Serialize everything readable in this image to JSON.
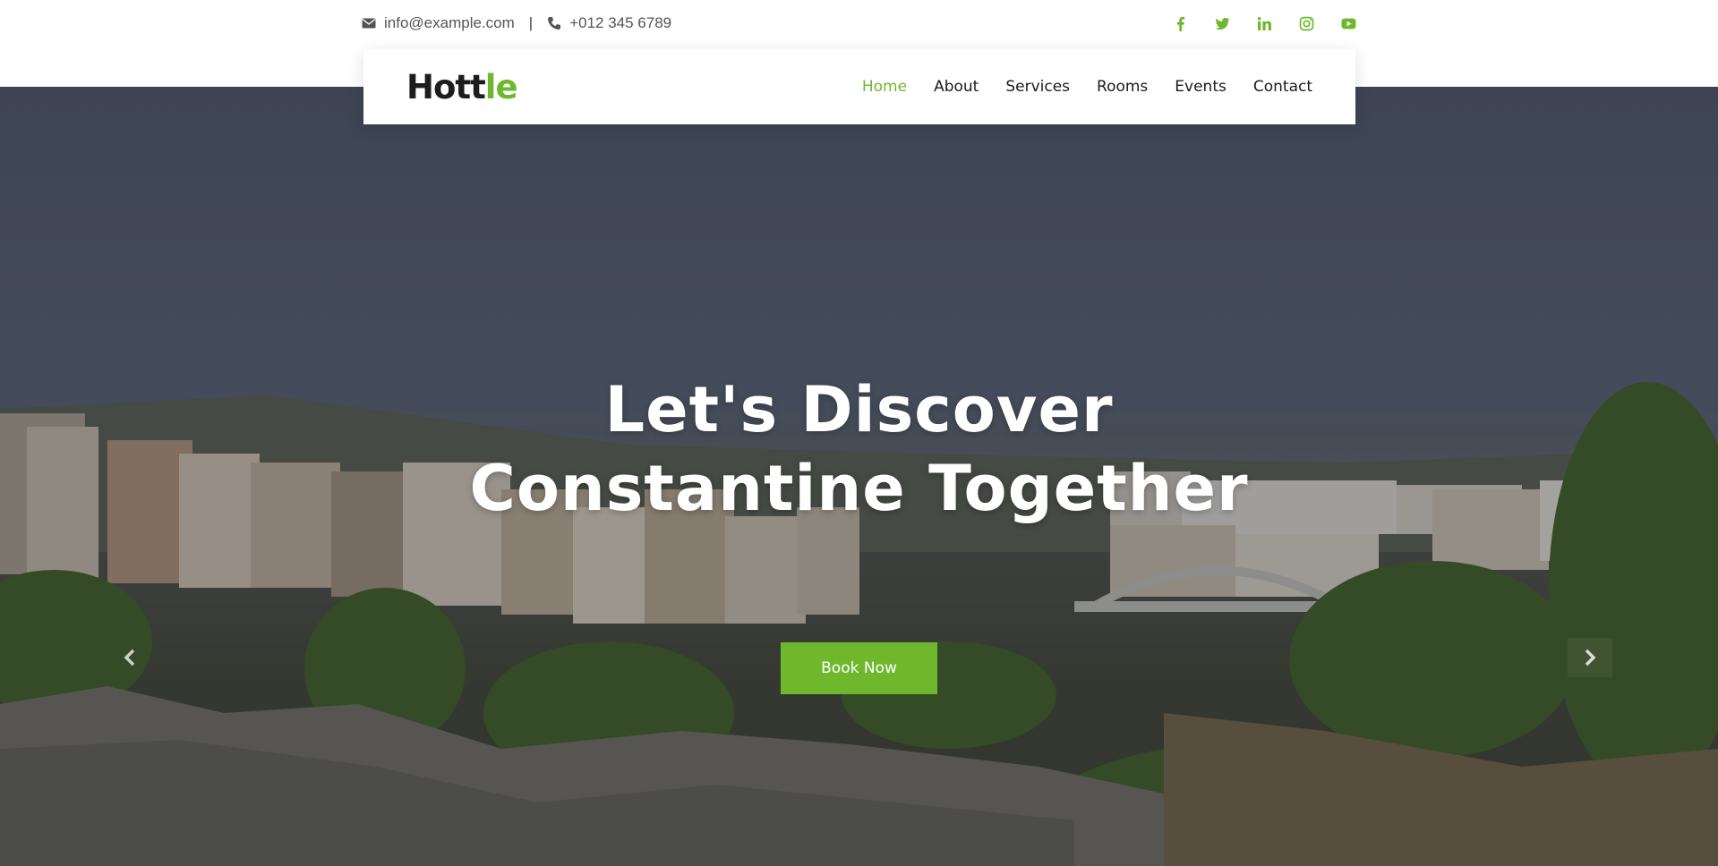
{
  "topbar": {
    "email": "info@example.com",
    "separator": "|",
    "phone": "+012 345 6789",
    "icons": [
      "envelope-icon",
      "phone-icon"
    ],
    "socials": [
      "facebook-icon",
      "twitter-icon",
      "linkedin-icon",
      "instagram-icon",
      "youtube-icon"
    ]
  },
  "brand": {
    "logo_main": "Hott",
    "logo_accent": "le",
    "accent_color": "#6fb82d"
  },
  "nav": {
    "items": [
      {
        "label": "Home",
        "active": true
      },
      {
        "label": "About",
        "active": false
      },
      {
        "label": "Services",
        "active": false
      },
      {
        "label": "Rooms",
        "active": false
      },
      {
        "label": "Events",
        "active": false
      },
      {
        "label": "Contact",
        "active": false
      }
    ]
  },
  "hero": {
    "line1": "Let's Discover",
    "line2": "Constantine Together",
    "button_label": "Book Now",
    "prev_icon": "chevron-left-icon",
    "next_icon": "chevron-right-icon"
  }
}
